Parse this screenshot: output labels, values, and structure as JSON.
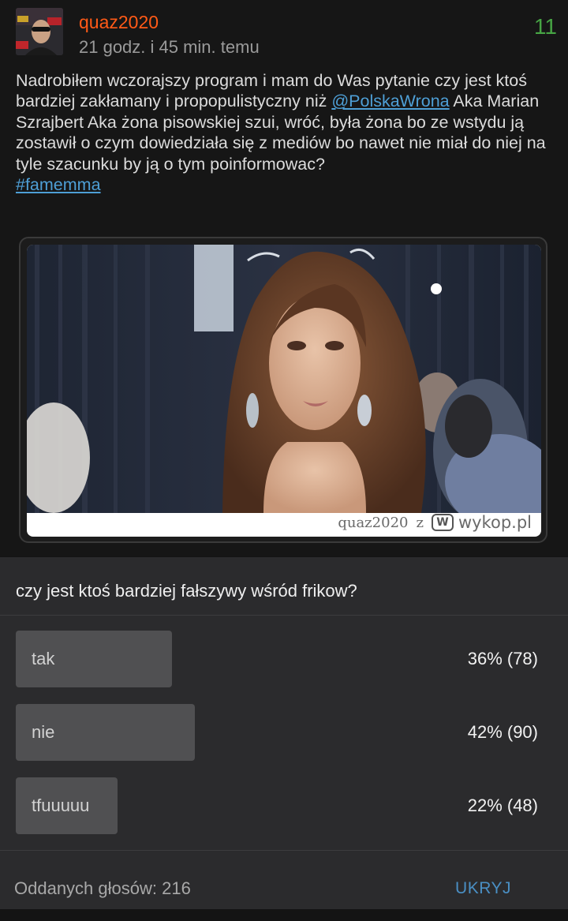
{
  "post": {
    "author": "quaz2020",
    "time": "21 godz. i 45 min. temu",
    "score": "11",
    "body_before_mention": "Nadrobiłem wczorajszy program i mam do Was pytanie czy jest ktoś bardziej zakłamany i propopulistyczny niż ",
    "mention": "@PolskaWrona",
    "body_after_mention": " Aka Marian Szrajbert Aka żona pisowskiej szui, wróć, była żona bo ze wstydu ją zostawił o czym dowiedziała się z mediów bo nawet nie miał do niej na tyle szacunku by ją o tym poinformowac?",
    "hashtag": "#famemma",
    "embed": {
      "caption_user": "quaz2020",
      "caption_z": "z",
      "logo_letter": "W",
      "site": "wykop.pl"
    }
  },
  "poll": {
    "question": "czy jest ktoś bardziej fałszywy wśród frikow?",
    "options": [
      {
        "label": "tak",
        "result": "36% (78)",
        "percent": 36
      },
      {
        "label": "nie",
        "result": "42% (90)",
        "percent": 42
      },
      {
        "label": "tfuuuuu",
        "result": "22% (48)",
        "percent": 22
      }
    ],
    "votes_text": "Oddanych głosów: 216",
    "hide_label": "UKRYJ"
  },
  "colors": {
    "author": "#ff5a17",
    "score": "#47a544",
    "link": "#4e9fd6",
    "poll_bg": "#2b2b2d",
    "poll_bar": "#505052"
  },
  "icons": {
    "wykop_logo": "wykop-logo-icon"
  }
}
